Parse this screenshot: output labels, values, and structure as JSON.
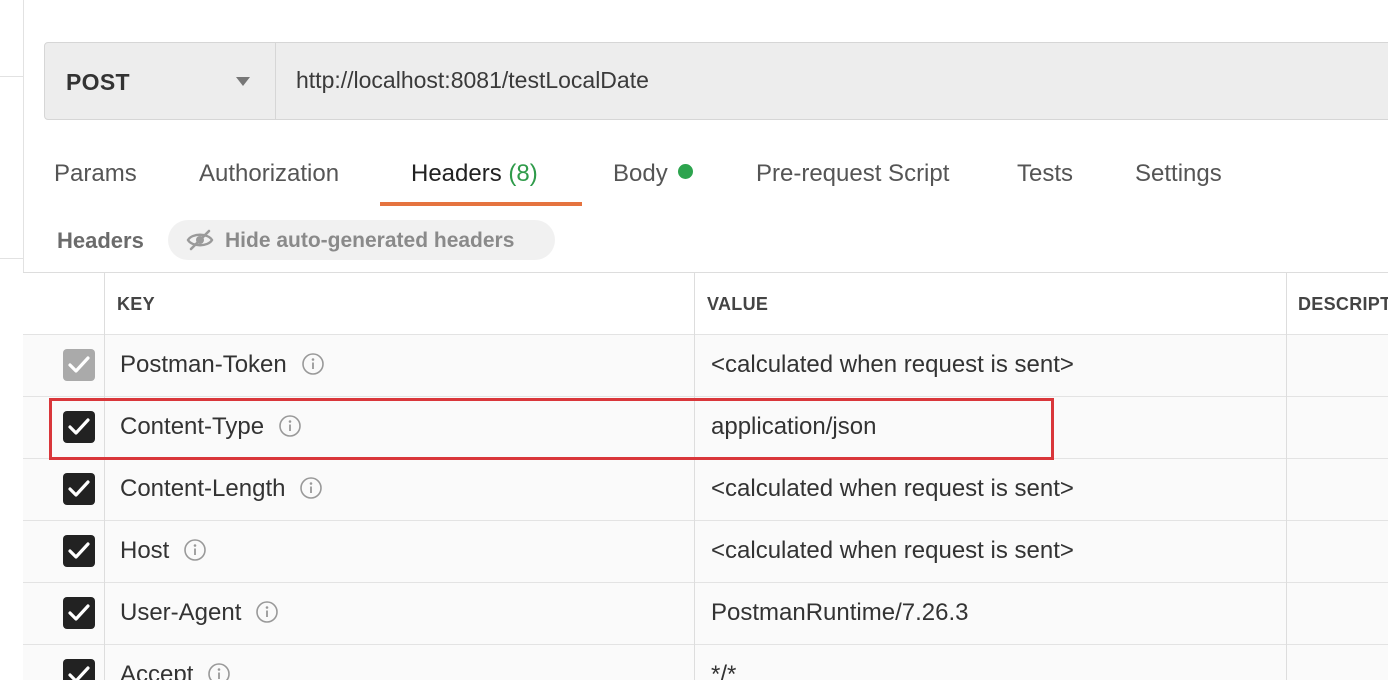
{
  "request": {
    "method": "POST",
    "url": "http://localhost:8081/testLocalDate"
  },
  "tabs": [
    {
      "label": "Params"
    },
    {
      "label": "Authorization"
    },
    {
      "label": "Headers",
      "count": "(8)",
      "active": true
    },
    {
      "label": "Body",
      "indicator": "green-dot"
    },
    {
      "label": "Pre-request Script"
    },
    {
      "label": "Tests"
    },
    {
      "label": "Settings"
    }
  ],
  "headers_section": {
    "title": "Headers",
    "toggle_label": "Hide auto-generated headers",
    "toggle_icon": "eye-slash-icon"
  },
  "table": {
    "columns": [
      "KEY",
      "VALUE",
      "DESCRIPT"
    ],
    "rows": [
      {
        "key": "Postman-Token",
        "value": "<calculated when request is sent>",
        "checked": true,
        "disabled": true
      },
      {
        "key": "Content-Type",
        "value": "application/json",
        "checked": true,
        "highlighted": true
      },
      {
        "key": "Content-Length",
        "value": "<calculated when request is sent>",
        "checked": true
      },
      {
        "key": "Host",
        "value": "<calculated when request is sent>",
        "checked": true
      },
      {
        "key": "User-Agent",
        "value": "PostmanRuntime/7.26.3",
        "checked": true
      },
      {
        "key": "Accept",
        "value": "*/*",
        "checked": true
      }
    ]
  },
  "colors": {
    "active_tab_underline": "#e5733f",
    "count_green": "#2f9b4a",
    "body_dot": "#2da44e",
    "highlight_border": "#d9363a"
  }
}
